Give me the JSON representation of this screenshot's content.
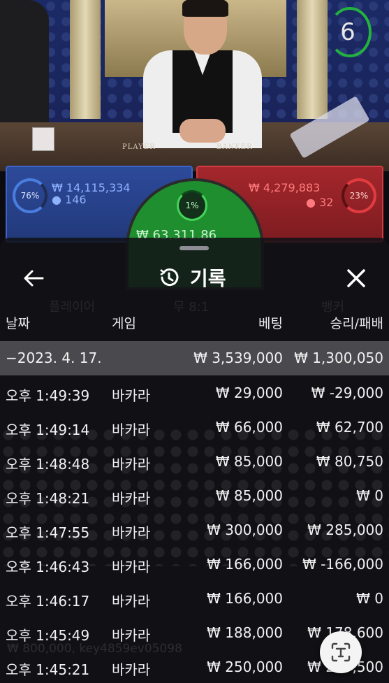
{
  "game": {
    "timer": "6",
    "player_percent": "76%",
    "player_amount": "₩ 14,115,334",
    "player_count": "146",
    "banker_percent": "23%",
    "banker_amount": "₩ 4,279,883",
    "banker_count": "32",
    "tie_percent": "1%",
    "tie_amount": "₩ 63,311.86",
    "table_label_player": "PLAYER",
    "table_label_banker": "BANKER",
    "colors": {
      "player": "#2d4a9a",
      "banker": "#a4272c",
      "tie": "#1e8e2f",
      "timer": "#23b23f"
    }
  },
  "sheet": {
    "title": "기록",
    "title_icon": "history-icon",
    "back_icon": "arrow-left-icon",
    "close_icon": "close-icon",
    "columns": {
      "date": "날짜",
      "game": "게임",
      "bet": "베팅",
      "result": "승리/패배"
    },
    "summary": {
      "date": "−2023. 4. 17.",
      "bet": "₩ 3,539,000",
      "result": "₩ 1,300,050"
    },
    "rows": [
      {
        "time": "오후 1:49:39",
        "game": "바카라",
        "bet": "₩ 29,000",
        "result": "₩ -29,000"
      },
      {
        "time": "오후 1:49:14",
        "game": "바카라",
        "bet": "₩ 66,000",
        "result": "₩ 62,700"
      },
      {
        "time": "오후 1:48:48",
        "game": "바카라",
        "bet": "₩ 85,000",
        "result": "₩ 80,750"
      },
      {
        "time": "오후 1:48:21",
        "game": "바카라",
        "bet": "₩ 85,000",
        "result": "₩ 0"
      },
      {
        "time": "오후 1:47:55",
        "game": "바카라",
        "bet": "₩ 300,000",
        "result": "₩ 285,000"
      },
      {
        "time": "오후 1:46:43",
        "game": "바카라",
        "bet": "₩ 166,000",
        "result": "₩ -166,000"
      },
      {
        "time": "오후 1:46:17",
        "game": "바카라",
        "bet": "₩ 166,000",
        "result": "₩ 0"
      },
      {
        "time": "오후 1:45:49",
        "game": "바카라",
        "bet": "₩ 188,000",
        "result": "₩ 178,600"
      },
      {
        "time": "오후 1:45:21",
        "game": "바카라",
        "bet": "₩ 250,000",
        "result": "₩ 237,500"
      }
    ],
    "ghost_text": {
      "player": "플레이어",
      "tie": "무 8:1",
      "banker": "뱅커"
    },
    "watermark": "₩ 800,000, key4859ev05098",
    "scan_icon": "text-scan-icon"
  }
}
